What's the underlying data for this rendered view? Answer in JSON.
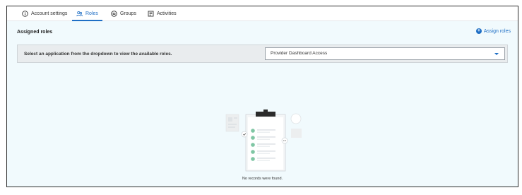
{
  "tabs": [
    {
      "label": "Account settings",
      "icon": "info-circle-icon",
      "active": false
    },
    {
      "label": "Roles",
      "icon": "users-icon",
      "active": true
    },
    {
      "label": "Groups",
      "icon": "group-icon",
      "active": false
    },
    {
      "label": "Activities",
      "icon": "activity-log-icon",
      "active": false
    }
  ],
  "section": {
    "title": "Assigned roles",
    "assign_label": "Assign roles"
  },
  "selector": {
    "prompt": "Select an application from the dropdown to view the available roles.",
    "selected_value": "Provider Dashboard Access"
  },
  "empty_state": {
    "message": "No records were found."
  },
  "colors": {
    "accent": "#1f6fc5",
    "panel_background": "#f1fafd",
    "check_green": "#7fc6a4"
  }
}
